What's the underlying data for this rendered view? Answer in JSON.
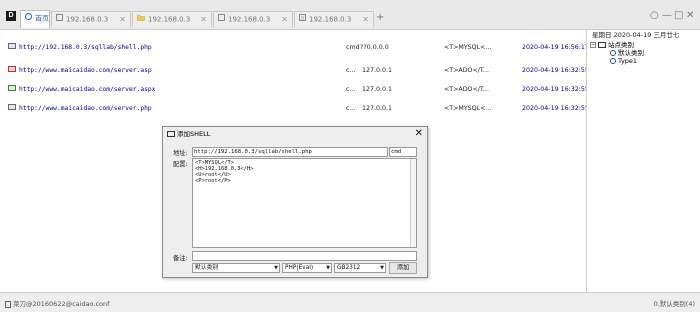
{
  "app": {
    "logo_glyph": "D"
  },
  "tabs": [
    {
      "label": "首页",
      "icon": "home-icon",
      "active": true
    },
    {
      "label": "192.168.0.3",
      "icon": "file-icon"
    },
    {
      "label": "192.168.0.3",
      "icon": "folder-icon"
    },
    {
      "label": "192.168.0.3",
      "icon": "file-icon"
    },
    {
      "label": "192.168.0.3",
      "icon": "file-icon"
    }
  ],
  "window_controls": {
    "minimize": "—",
    "maximize": "□",
    "close": "✕"
  },
  "shells": [
    {
      "badge": "PHP",
      "url": "http://192.168.0.3/sqllab/shell.php",
      "password": "cmd",
      "ip": "??0.0.0.0",
      "db": "<T>MYSQL<...",
      "time": "2020-04-19 16:56:17"
    },
    {
      "badge": "ASP",
      "url": "http://www.maicaidao.com/server.asp",
      "password": "c...",
      "ip": "127.0.0.1",
      "db": "<T>ADO</T...",
      "time": "2020-04-19 16:32:55"
    },
    {
      "badge": "ASPX",
      "url": "http://www.maicaidao.com/server.aspx",
      "password": "c...",
      "ip": "127.0.0.1",
      "db": "<T>ADO</T...",
      "time": "2020-04-19 16:32:55"
    },
    {
      "badge": "PHP",
      "url": "http://www.maicaidao.com/server.php",
      "password": "c...",
      "ip": "127.0.0.1",
      "db": "<T>MYSQL<...",
      "time": "2020-04-19 16:32:55"
    }
  ],
  "side": {
    "date": "星期日 2020-04-19 三月廿七",
    "tree": {
      "root": "站点类别",
      "expander": "−",
      "children": [
        "默认类别",
        "Type1"
      ]
    }
  },
  "status": {
    "left": "菜刀@20160622@caidao.conf",
    "right": "0.默认类别(4)"
  },
  "dialog": {
    "title": "添加SHELL",
    "close": "✕",
    "addr_label": "地址:",
    "url_value": "http://192.168.0.3/sqllab/shell.php",
    "pass_value": "cmd",
    "cfg_label": "配置:",
    "cfg_text": "<T>MYSQL</T>\n<H>192.168.0.3</H>\n<U>root</U>\n<P>root</P>",
    "note_label": "备注:",
    "category": "默认类别",
    "script_type": "PHP(Eval)",
    "encoding": "GB2312",
    "add_button": "添加",
    "arrow": "▼"
  }
}
